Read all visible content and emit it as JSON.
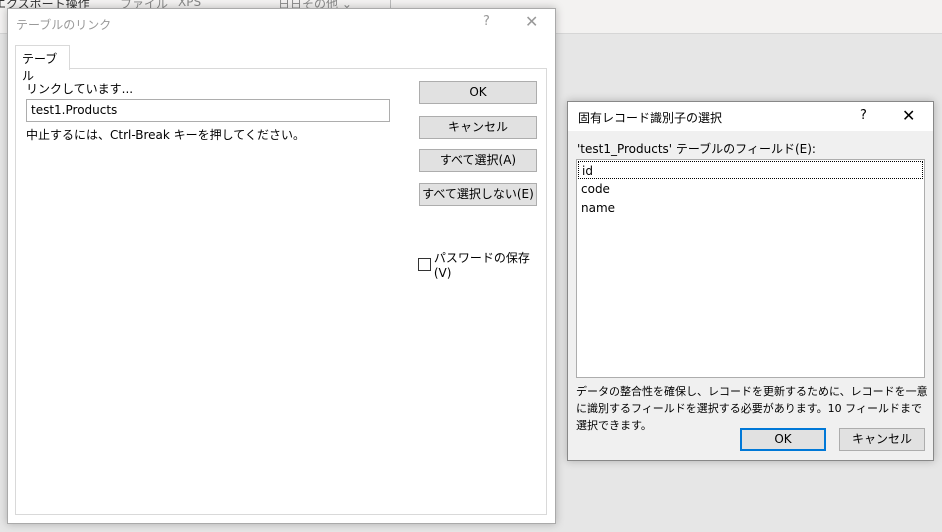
{
  "background": {
    "ribbon": [
      "エクスポート操作",
      "ファイル",
      "XPS",
      "日日その他 ⌄"
    ]
  },
  "link_dialog": {
    "title": "テーブルのリンク",
    "help": "?",
    "close": "✕",
    "tab": "テーブル",
    "status_label": "リンクしています...",
    "table_value": "test1.Products",
    "hint": "中止するには、Ctrl-Break キーを押してください。",
    "buttons": {
      "ok": "OK",
      "cancel": "キャンセル",
      "select_all": "すべて選択(A)",
      "deselect_all": "すべて選択しない(E)"
    },
    "save_password": {
      "label": "パスワードの保存(V)",
      "checked": false
    }
  },
  "pk_dialog": {
    "title": "固有レコード識別子の選択",
    "help": "?",
    "close": "✕",
    "fields_label": "'test1_Products' テーブルのフィールド(E):",
    "fields": [
      "id",
      "code",
      "name"
    ],
    "selected": "id",
    "description": "データの整合性を確保し、レコードを更新するために、レコードを一意に識別するフィールドを選択する必要があります。10 フィールドまで選択できます。",
    "ok": "OK",
    "cancel": "キャンセル",
    "accent": "#0078d7"
  }
}
